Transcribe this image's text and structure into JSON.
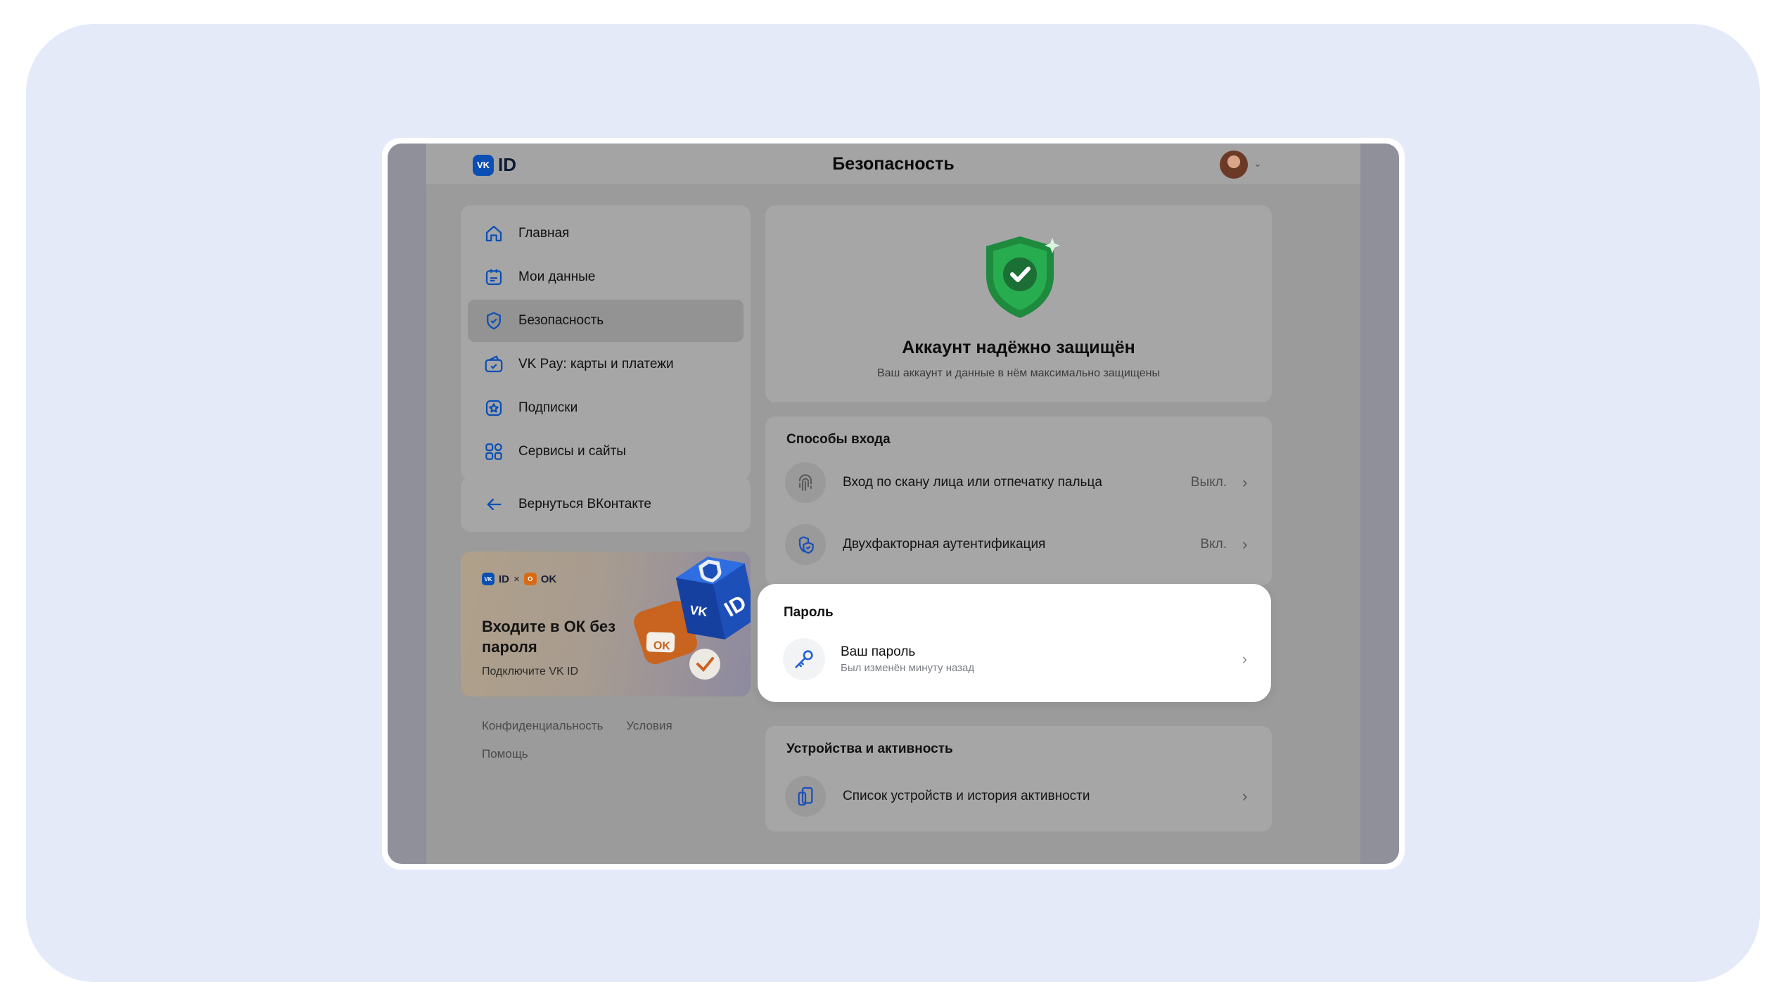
{
  "header": {
    "logo_mark": "VK",
    "logo_text": "ID",
    "title": "Безопасность"
  },
  "sidebar": {
    "items": [
      {
        "label": "Главная",
        "icon": "home-icon"
      },
      {
        "label": "Мои данные",
        "icon": "profile-card-icon"
      },
      {
        "label": "Безопасность",
        "icon": "shield-icon",
        "active": true
      },
      {
        "label": "VK Pay: карты и платежи",
        "icon": "wallet-icon"
      },
      {
        "label": "Подписки",
        "icon": "star-icon"
      },
      {
        "label": "Сервисы и сайты",
        "icon": "services-grid-icon"
      }
    ],
    "back_label": "Вернуться ВКонтакте"
  },
  "promo": {
    "logo_vk": "ID",
    "separator": "×",
    "logo_ok": "OK",
    "title": "Входите в ОК без пароля",
    "subtitle": "Подключите VK ID"
  },
  "footer": {
    "privacy": "Конфиденциальность",
    "terms": "Условия",
    "help": "Помощь"
  },
  "status": {
    "title": "Аккаунт надёжно защищён",
    "subtitle": "Ваш аккаунт и данные в нём максимально защищены"
  },
  "login_methods": {
    "title": "Способы входа",
    "rows": [
      {
        "label": "Вход по скану лица или отпечатку пальца",
        "value": "Выкл."
      },
      {
        "label": "Двухфакторная аутентификация",
        "value": "Вкл."
      }
    ]
  },
  "password": {
    "title": "Пароль",
    "label": "Ваш пароль",
    "sublabel": "Был изменён минуту назад"
  },
  "devices": {
    "title": "Устройства и активность",
    "label": "Список устройств и история активности"
  },
  "colors": {
    "backdrop": "#e4eaf8",
    "accent_blue": "#0b4fb4",
    "shield_green": "#1fa04a",
    "overlay_gray": "#9b9b9b"
  }
}
